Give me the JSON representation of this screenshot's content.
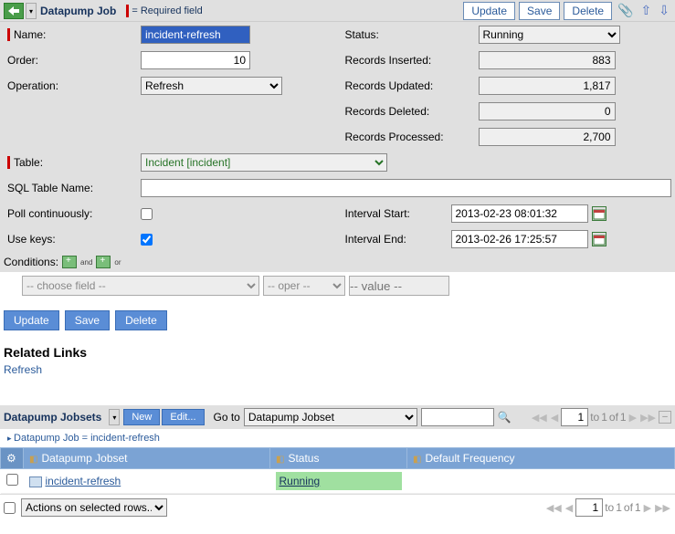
{
  "header": {
    "title": "Datapump Job",
    "required_label": "= Required field",
    "buttons": {
      "update": "Update",
      "save": "Save",
      "delete": "Delete"
    }
  },
  "form": {
    "name_label": "Name:",
    "name_value": "incident-refresh",
    "order_label": "Order:",
    "order_value": "10",
    "operation_label": "Operation:",
    "operation_value": "Refresh",
    "status_label": "Status:",
    "status_value": "Running",
    "records_inserted_label": "Records Inserted:",
    "records_inserted_value": "883",
    "records_updated_label": "Records Updated:",
    "records_updated_value": "1,817",
    "records_deleted_label": "Records Deleted:",
    "records_deleted_value": "0",
    "records_processed_label": "Records Processed:",
    "records_processed_value": "2,700",
    "table_label": "Table:",
    "table_value": "Incident [incident]",
    "sql_label": "SQL Table Name:",
    "sql_value": "",
    "poll_label": "Poll continuously:",
    "poll_checked": false,
    "usekeys_label": "Use keys:",
    "usekeys_checked": true,
    "interval_start_label": "Interval Start:",
    "interval_start_value": "2013-02-23 08:01:32",
    "interval_end_label": "Interval End:",
    "interval_end_value": "2013-02-26 17:25:57",
    "conditions_label": "Conditions:"
  },
  "filter": {
    "field_placeholder": "-- choose field --",
    "oper_placeholder": "-- oper --",
    "value_placeholder": "-- value --"
  },
  "buttons": {
    "update": "Update",
    "save": "Save",
    "delete": "Delete"
  },
  "related": {
    "title": "Related Links",
    "refresh": "Refresh"
  },
  "list": {
    "title": "Datapump Jobsets",
    "new_btn": "New",
    "edit_btn": "Edit...",
    "goto_label": "Go to",
    "goto_value": "Datapump Jobset",
    "breadcrumb": "Datapump Job = incident-refresh",
    "col_jobset": "Datapump Jobset",
    "col_status": "Status",
    "col_freq": "Default Frequency",
    "row_jobset": "incident-refresh",
    "row_status": "Running",
    "pager_page": "1",
    "pager_to": "to",
    "pager_of": "of",
    "pager_total1": "1",
    "pager_total2": "1",
    "actions_label": "Actions on selected rows..."
  }
}
